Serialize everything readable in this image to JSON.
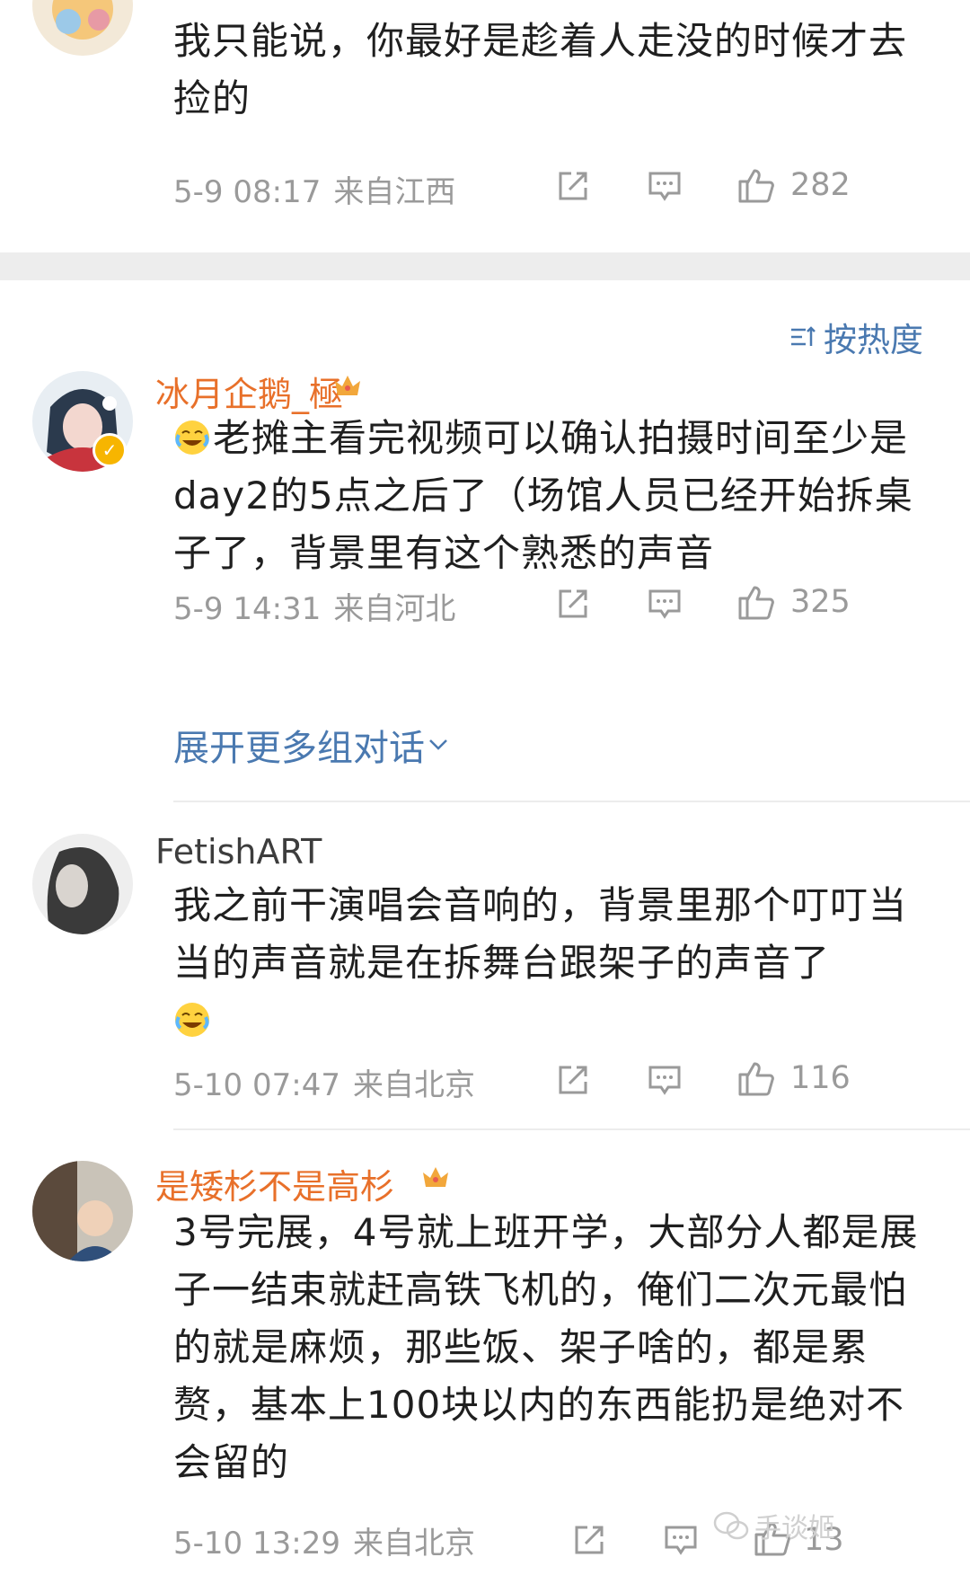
{
  "comments": [
    {
      "text": "我只能说，你最好是趁着人走没的时候才去捡的",
      "date": "5-9 08:17",
      "location": "来自江西",
      "likes": "282"
    },
    {
      "username": "冰月企鹅_極",
      "text": "老摊主看完视频可以确认拍摄时间至少是day2的5点之后了（场馆人员已经开始拆桌子了，背景里有这个熟悉的声音",
      "date": "5-9 14:31",
      "location": "来自河北",
      "likes": "325",
      "expand_label": "展开更多组对话"
    },
    {
      "username": "FetishART",
      "text": "我之前干演唱会音响的，背景里那个叮叮当当的声音就是在拆舞台跟架子的声音了",
      "date": "5-10 07:47",
      "location": "来自北京",
      "likes": "116"
    },
    {
      "username": "是矮杉不是高杉",
      "text": "3号完展，4号就上班开学，大部分人都是展子一结束就赶高铁飞机的，俺们二次元最怕的就是麻烦，那些饭、架子啥的，都是累赘，基本上100块以内的东西能扔是绝对不会留的",
      "date": "5-10 13:29",
      "location": "来自北京",
      "likes": "13"
    }
  ],
  "sort_label": "按热度",
  "watermark": "手谈姬",
  "colors": {
    "username": "#e8702a",
    "link": "#4a79b0",
    "meta": "#9a9a9a"
  }
}
